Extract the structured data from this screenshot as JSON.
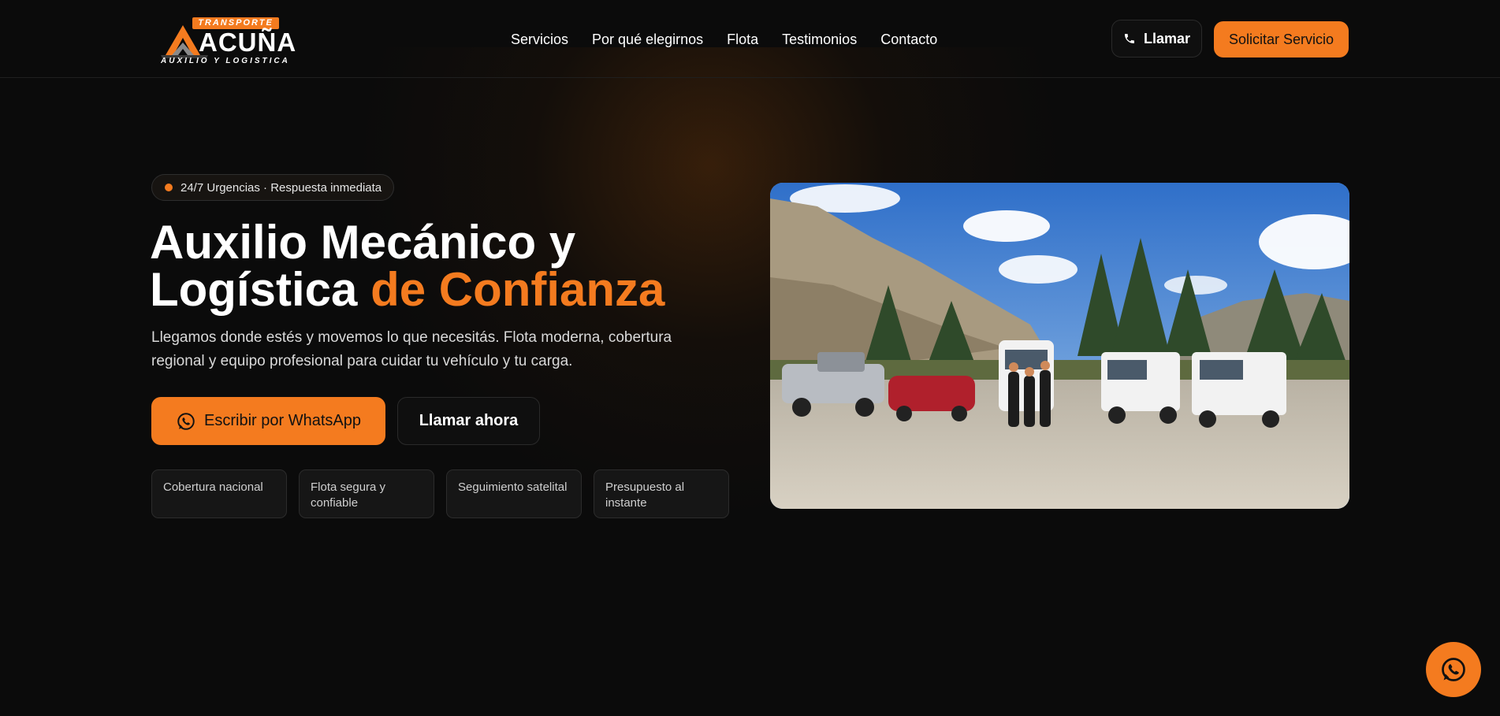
{
  "header": {
    "logo": {
      "badge": "TRANSPORTE",
      "name": "ACUÑA",
      "tagline": "AUXILIO Y LOGISTICA"
    },
    "nav": [
      "Servicios",
      "Por qué elegirnos",
      "Flota",
      "Testimonios",
      "Contacto"
    ],
    "call_label": "Llamar",
    "request_label": "Solicitar Servicio"
  },
  "hero": {
    "pill": "24/7 Urgencias · Respuesta inmediata",
    "title_line1": "Auxilio Mecánico y",
    "title_line2_plain": "Logística",
    "title_line2_accent": "de Confianza",
    "subtitle": "Llegamos donde estés y movemos lo que necesitás. Flota moderna, cobertura regional y equipo profesional para cuidar tu vehículo y tu carga.",
    "whatsapp_label": "Escribir por WhatsApp",
    "call_now_label": "Llamar ahora",
    "features": [
      "Cobertura nacional",
      "Flota segura y confiable",
      "Seguimiento satelital",
      "Presupuesto al instante"
    ],
    "photo_icon": "fleet-photo"
  },
  "colors": {
    "accent": "#f47b1f",
    "background": "#0b0b0b"
  },
  "icons": {
    "phone": "phone-icon",
    "whatsapp": "whatsapp-icon"
  }
}
